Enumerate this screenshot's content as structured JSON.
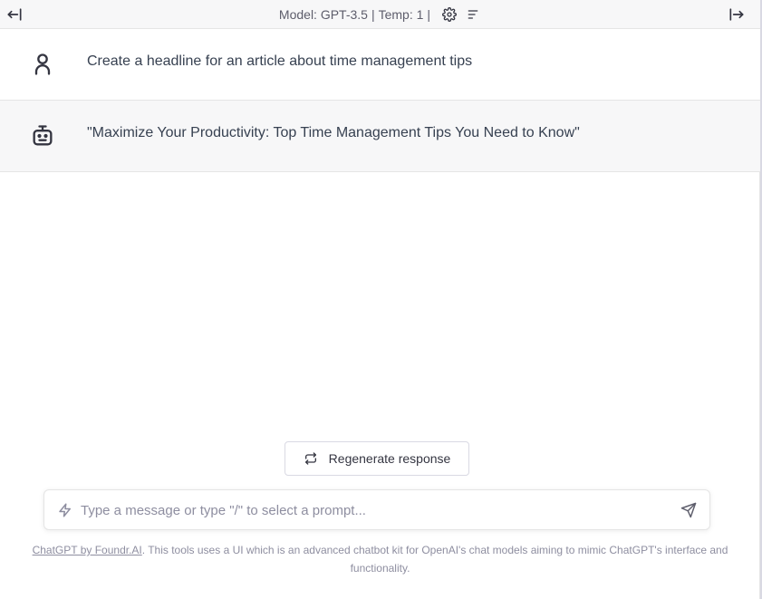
{
  "header": {
    "model_label": "Model: GPT-3.5",
    "temp_label": "Temp: 1",
    "separator": "|",
    "left_icon": "arrow-left-to-bar-icon",
    "right_icon": "arrow-right-from-bar-icon",
    "settings_icon": "gear-icon",
    "clear_icon": "lines-icon"
  },
  "messages": [
    {
      "role": "user",
      "icon": "user-icon",
      "text": "Create a headline for an article about time management tips"
    },
    {
      "role": "assistant",
      "icon": "robot-icon",
      "text": "\"Maximize Your Productivity: Top Time Management Tips You Need to Know\""
    }
  ],
  "regenerate": {
    "label": "Regenerate response",
    "icon": "repeat-icon"
  },
  "composer": {
    "placeholder": "Type a message or type \"/\" to select a prompt...",
    "value": "",
    "left_icon": "bolt-icon",
    "send_icon": "send-icon"
  },
  "footer": {
    "link_text": "ChatGPT by Foundr.AI",
    "text": ". This tools uses a UI which is an advanced chatbot kit for OpenAI's chat models aiming to mimic ChatGPT's interface and functionality."
  },
  "colors": {
    "text": "#343541",
    "muted": "#8e8ea0",
    "assistant_bg": "#f7f7f8",
    "border": "#e5e5e5"
  }
}
